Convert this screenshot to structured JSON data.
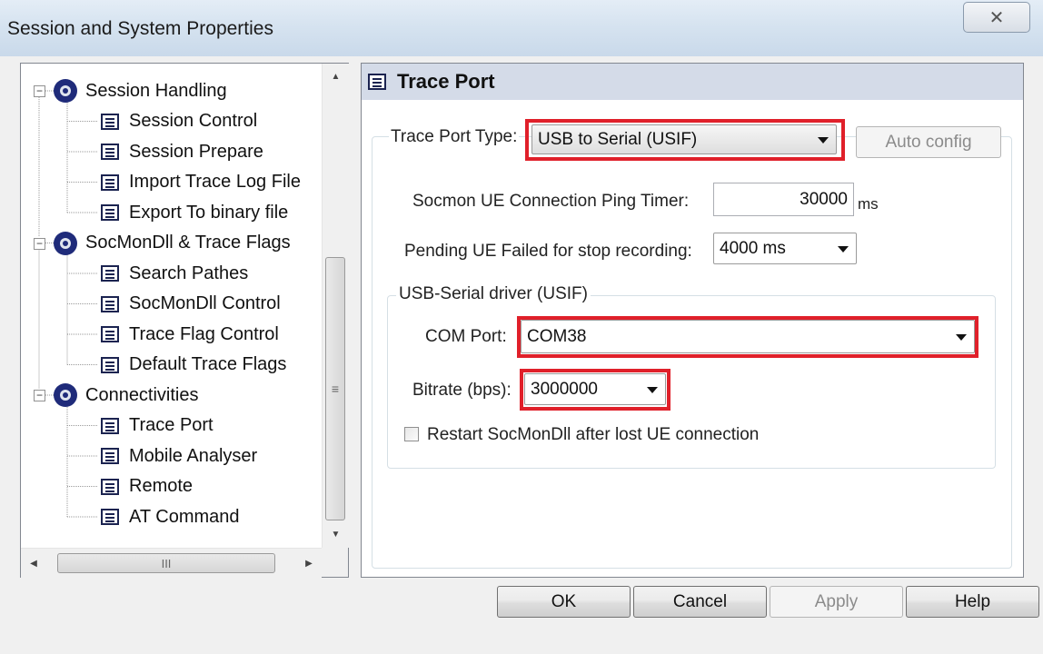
{
  "window": {
    "title": "Session and System Properties",
    "close_glyph": "✕"
  },
  "tree": {
    "items": [
      {
        "label": "Session Handling",
        "icon": "gear-icon",
        "level": 0,
        "expander": "−"
      },
      {
        "label": "Session Control",
        "icon": "document-icon",
        "level": 1
      },
      {
        "label": "Session Prepare",
        "icon": "document-icon",
        "level": 1
      },
      {
        "label": "Import Trace Log File",
        "icon": "document-icon",
        "level": 1
      },
      {
        "label": "Export To binary file",
        "icon": "document-icon",
        "level": 1
      },
      {
        "label": "SocMonDll & Trace Flags",
        "icon": "gear-icon",
        "level": 0,
        "expander": "−"
      },
      {
        "label": "Search Pathes",
        "icon": "document-icon",
        "level": 1
      },
      {
        "label": "SocMonDll Control",
        "icon": "document-icon",
        "level": 1
      },
      {
        "label": "Trace Flag Control",
        "icon": "document-icon",
        "level": 1
      },
      {
        "label": "Default Trace Flags",
        "icon": "document-icon",
        "level": 1
      },
      {
        "label": "Connectivities",
        "icon": "gear-icon",
        "level": 0,
        "expander": "−"
      },
      {
        "label": "Trace Port",
        "icon": "document-icon",
        "level": 1,
        "selected": true
      },
      {
        "label": "Mobile Analyser",
        "icon": "document-icon",
        "level": 1
      },
      {
        "label": "Remote",
        "icon": "document-icon",
        "level": 1
      },
      {
        "label": "AT Command",
        "icon": "document-icon",
        "level": 1
      }
    ],
    "scroll_glyphs": {
      "up": "▲",
      "down": "▼",
      "left": "◀",
      "right": "▶",
      "vgrip": "≡",
      "hgrip": "III"
    }
  },
  "panel": {
    "title": "Trace Port",
    "trace_port_type_label": "Trace Port Type:",
    "trace_port_type_value": "USB to Serial (USIF)",
    "auto_config_label": "Auto config",
    "ping_timer_label": "Socmon UE Connection Ping Timer:",
    "ping_timer_value": "30000",
    "ping_timer_unit": "ms",
    "pending_label": "Pending UE Failed for stop recording:",
    "pending_value": "4000 ms",
    "usb_group_label": "USB-Serial driver (USIF)",
    "com_port_label": "COM Port:",
    "com_port_value": "COM38",
    "bitrate_label": "Bitrate (bps):",
    "bitrate_value": "3000000",
    "restart_label": "Restart SocMonDll after lost UE connection",
    "restart_checked": false
  },
  "buttons": {
    "ok": "OK",
    "cancel": "Cancel",
    "apply": "Apply",
    "help": "Help"
  },
  "colors": {
    "highlight": "#e0202a",
    "header_bg": "#d4dbe8"
  }
}
